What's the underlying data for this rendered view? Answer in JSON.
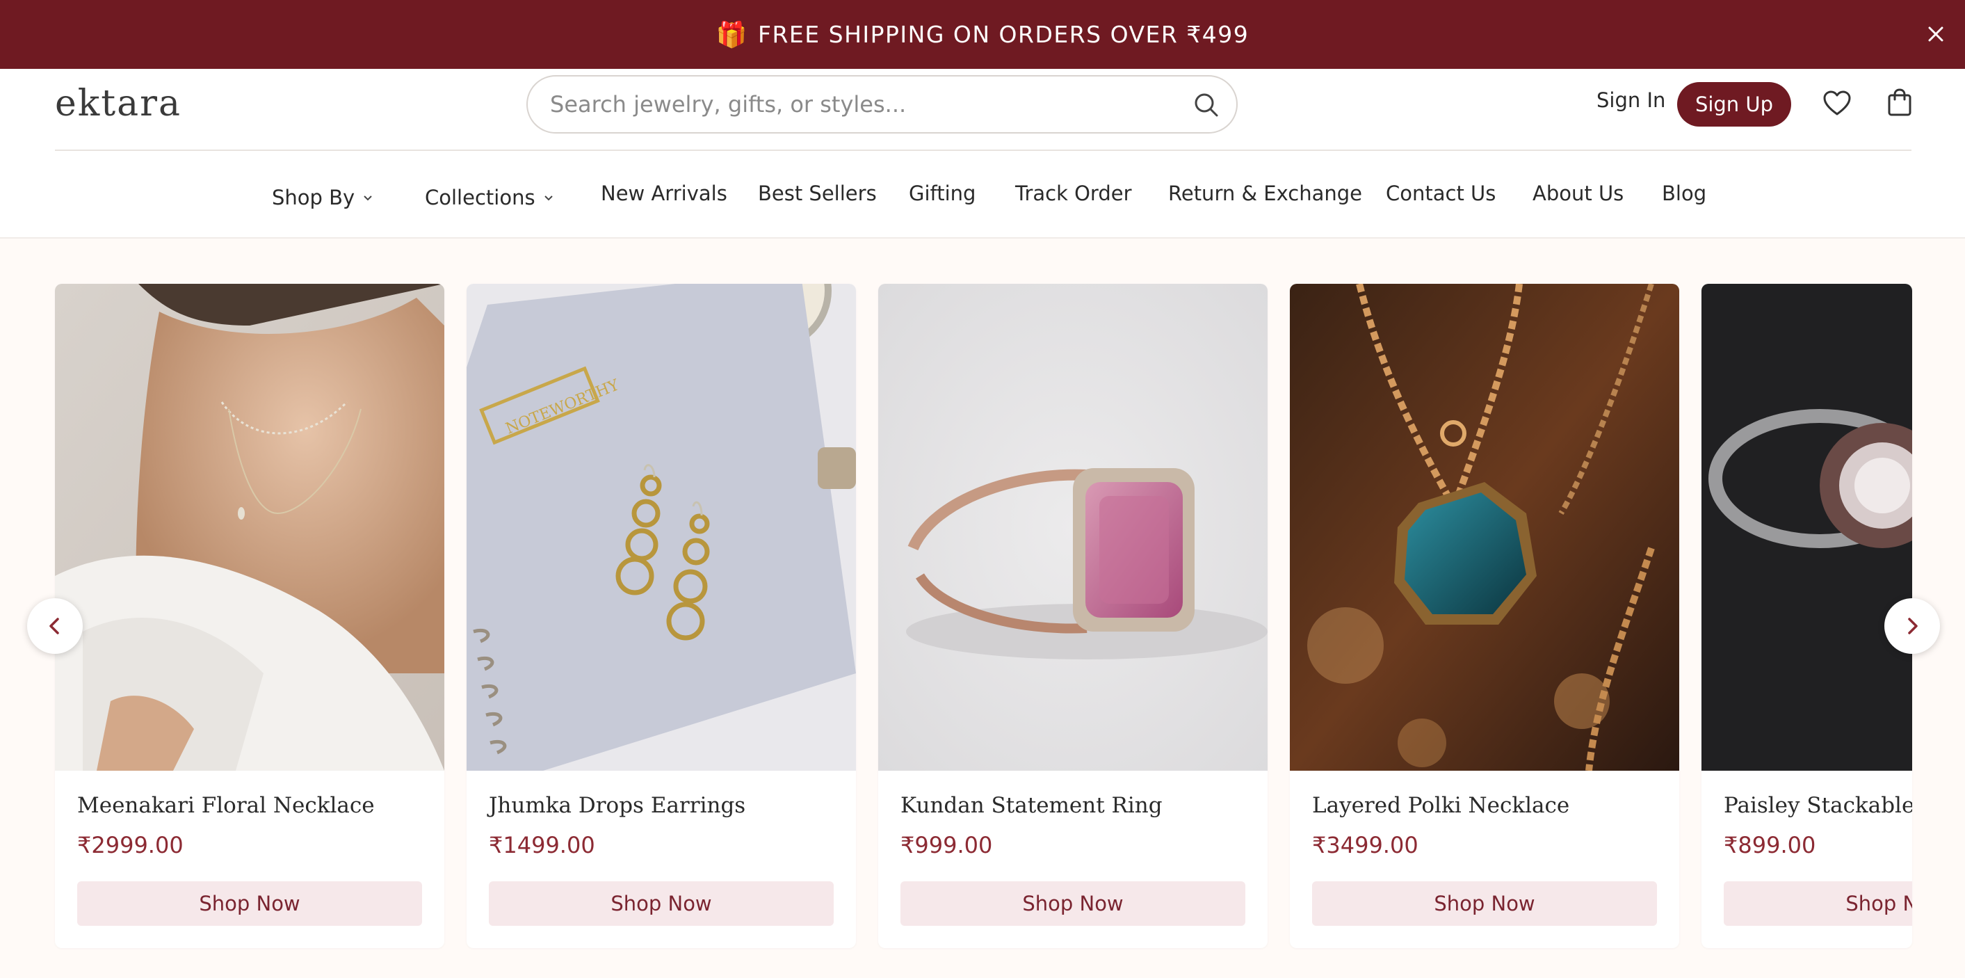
{
  "promo": {
    "gift_icon": "gift-icon",
    "text": "FREE SHIPPING ON ORDERS OVER ₹499",
    "close_icon": "close-icon"
  },
  "header": {
    "logo": "ektara",
    "search_placeholder": "Search jewelry, gifts, or styles...",
    "search_icon": "search-icon",
    "sign_in": "Sign In",
    "sign_up": "Sign Up",
    "wishlist_icon": "heart-icon",
    "cart_icon": "shopping-bag-icon"
  },
  "nav": {
    "items": [
      "Shop By",
      "Collections",
      "New Arrivals",
      "Best Sellers",
      "Gifting",
      "Track Order",
      "Return & Exchange",
      "Contact Us",
      "About Us",
      "Blog"
    ]
  },
  "products": [
    {
      "title": "Meenakari Floral Necklace",
      "price": "₹2999.00",
      "cta": "Shop Now"
    },
    {
      "title": "Jhumka Drops Earrings",
      "price": "₹1499.00",
      "cta": "Shop Now"
    },
    {
      "title": "Kundan Statement Ring",
      "price": "₹999.00",
      "cta": "Shop Now"
    },
    {
      "title": "Layered Polki Necklace",
      "price": "₹3499.00",
      "cta": "Shop Now"
    },
    {
      "title": "Paisley Stackable Ring",
      "price": "₹899.00",
      "cta": "Shop Now"
    }
  ],
  "colors": {
    "brand": "#6f1a22",
    "price": "#8c2a33",
    "button_bg": "#f6e8ea"
  }
}
